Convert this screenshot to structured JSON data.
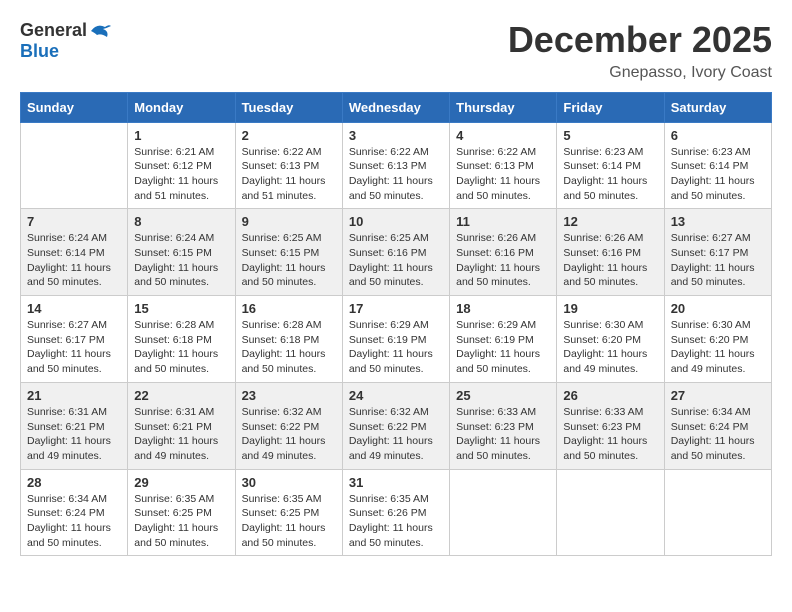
{
  "header": {
    "logo_general": "General",
    "logo_blue": "Blue",
    "month_title": "December 2025",
    "location": "Gnepasso, Ivory Coast"
  },
  "days_of_week": [
    "Sunday",
    "Monday",
    "Tuesday",
    "Wednesday",
    "Thursday",
    "Friday",
    "Saturday"
  ],
  "weeks": [
    [
      {
        "day": "",
        "info": ""
      },
      {
        "day": "1",
        "info": "Sunrise: 6:21 AM\nSunset: 6:12 PM\nDaylight: 11 hours\nand 51 minutes."
      },
      {
        "day": "2",
        "info": "Sunrise: 6:22 AM\nSunset: 6:13 PM\nDaylight: 11 hours\nand 51 minutes."
      },
      {
        "day": "3",
        "info": "Sunrise: 6:22 AM\nSunset: 6:13 PM\nDaylight: 11 hours\nand 50 minutes."
      },
      {
        "day": "4",
        "info": "Sunrise: 6:22 AM\nSunset: 6:13 PM\nDaylight: 11 hours\nand 50 minutes."
      },
      {
        "day": "5",
        "info": "Sunrise: 6:23 AM\nSunset: 6:14 PM\nDaylight: 11 hours\nand 50 minutes."
      },
      {
        "day": "6",
        "info": "Sunrise: 6:23 AM\nSunset: 6:14 PM\nDaylight: 11 hours\nand 50 minutes."
      }
    ],
    [
      {
        "day": "7",
        "info": "Sunrise: 6:24 AM\nSunset: 6:14 PM\nDaylight: 11 hours\nand 50 minutes."
      },
      {
        "day": "8",
        "info": "Sunrise: 6:24 AM\nSunset: 6:15 PM\nDaylight: 11 hours\nand 50 minutes."
      },
      {
        "day": "9",
        "info": "Sunrise: 6:25 AM\nSunset: 6:15 PM\nDaylight: 11 hours\nand 50 minutes."
      },
      {
        "day": "10",
        "info": "Sunrise: 6:25 AM\nSunset: 6:16 PM\nDaylight: 11 hours\nand 50 minutes."
      },
      {
        "day": "11",
        "info": "Sunrise: 6:26 AM\nSunset: 6:16 PM\nDaylight: 11 hours\nand 50 minutes."
      },
      {
        "day": "12",
        "info": "Sunrise: 6:26 AM\nSunset: 6:16 PM\nDaylight: 11 hours\nand 50 minutes."
      },
      {
        "day": "13",
        "info": "Sunrise: 6:27 AM\nSunset: 6:17 PM\nDaylight: 11 hours\nand 50 minutes."
      }
    ],
    [
      {
        "day": "14",
        "info": "Sunrise: 6:27 AM\nSunset: 6:17 PM\nDaylight: 11 hours\nand 50 minutes."
      },
      {
        "day": "15",
        "info": "Sunrise: 6:28 AM\nSunset: 6:18 PM\nDaylight: 11 hours\nand 50 minutes."
      },
      {
        "day": "16",
        "info": "Sunrise: 6:28 AM\nSunset: 6:18 PM\nDaylight: 11 hours\nand 50 minutes."
      },
      {
        "day": "17",
        "info": "Sunrise: 6:29 AM\nSunset: 6:19 PM\nDaylight: 11 hours\nand 50 minutes."
      },
      {
        "day": "18",
        "info": "Sunrise: 6:29 AM\nSunset: 6:19 PM\nDaylight: 11 hours\nand 50 minutes."
      },
      {
        "day": "19",
        "info": "Sunrise: 6:30 AM\nSunset: 6:20 PM\nDaylight: 11 hours\nand 49 minutes."
      },
      {
        "day": "20",
        "info": "Sunrise: 6:30 AM\nSunset: 6:20 PM\nDaylight: 11 hours\nand 49 minutes."
      }
    ],
    [
      {
        "day": "21",
        "info": "Sunrise: 6:31 AM\nSunset: 6:21 PM\nDaylight: 11 hours\nand 49 minutes."
      },
      {
        "day": "22",
        "info": "Sunrise: 6:31 AM\nSunset: 6:21 PM\nDaylight: 11 hours\nand 49 minutes."
      },
      {
        "day": "23",
        "info": "Sunrise: 6:32 AM\nSunset: 6:22 PM\nDaylight: 11 hours\nand 49 minutes."
      },
      {
        "day": "24",
        "info": "Sunrise: 6:32 AM\nSunset: 6:22 PM\nDaylight: 11 hours\nand 49 minutes."
      },
      {
        "day": "25",
        "info": "Sunrise: 6:33 AM\nSunset: 6:23 PM\nDaylight: 11 hours\nand 50 minutes."
      },
      {
        "day": "26",
        "info": "Sunrise: 6:33 AM\nSunset: 6:23 PM\nDaylight: 11 hours\nand 50 minutes."
      },
      {
        "day": "27",
        "info": "Sunrise: 6:34 AM\nSunset: 6:24 PM\nDaylight: 11 hours\nand 50 minutes."
      }
    ],
    [
      {
        "day": "28",
        "info": "Sunrise: 6:34 AM\nSunset: 6:24 PM\nDaylight: 11 hours\nand 50 minutes."
      },
      {
        "day": "29",
        "info": "Sunrise: 6:35 AM\nSunset: 6:25 PM\nDaylight: 11 hours\nand 50 minutes."
      },
      {
        "day": "30",
        "info": "Sunrise: 6:35 AM\nSunset: 6:25 PM\nDaylight: 11 hours\nand 50 minutes."
      },
      {
        "day": "31",
        "info": "Sunrise: 6:35 AM\nSunset: 6:26 PM\nDaylight: 11 hours\nand 50 minutes."
      },
      {
        "day": "",
        "info": ""
      },
      {
        "day": "",
        "info": ""
      },
      {
        "day": "",
        "info": ""
      }
    ]
  ]
}
